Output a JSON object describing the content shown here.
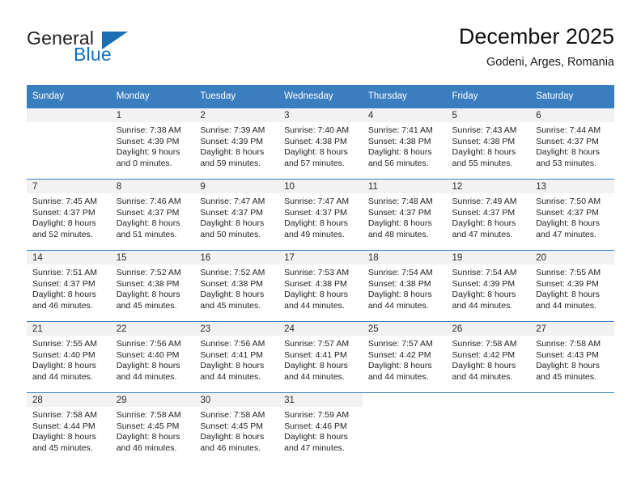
{
  "brand": {
    "name_part1": "General",
    "name_part2": "Blue",
    "triangle_color": "#1a6fb5",
    "text_color": "#231f20",
    "blue_color": "#1170bf"
  },
  "header": {
    "title": "December 2025",
    "location": "Godeni, Arges, Romania"
  },
  "theme": {
    "header_bg": "#3b7ebf",
    "header_text": "#ffffff",
    "daynum_band_bg": "#f2f2f2",
    "grid_line": "#3b7ebf",
    "body_text": "#222222"
  },
  "weekdays": [
    "Sunday",
    "Monday",
    "Tuesday",
    "Wednesday",
    "Thursday",
    "Friday",
    "Saturday"
  ],
  "weeks": [
    [
      {
        "day": "",
        "lines": []
      },
      {
        "day": "1",
        "lines": [
          "Sunrise: 7:38 AM",
          "Sunset: 4:39 PM",
          "Daylight: 9 hours",
          "and 0 minutes."
        ]
      },
      {
        "day": "2",
        "lines": [
          "Sunrise: 7:39 AM",
          "Sunset: 4:39 PM",
          "Daylight: 8 hours",
          "and 59 minutes."
        ]
      },
      {
        "day": "3",
        "lines": [
          "Sunrise: 7:40 AM",
          "Sunset: 4:38 PM",
          "Daylight: 8 hours",
          "and 57 minutes."
        ]
      },
      {
        "day": "4",
        "lines": [
          "Sunrise: 7:41 AM",
          "Sunset: 4:38 PM",
          "Daylight: 8 hours",
          "and 56 minutes."
        ]
      },
      {
        "day": "5",
        "lines": [
          "Sunrise: 7:43 AM",
          "Sunset: 4:38 PM",
          "Daylight: 8 hours",
          "and 55 minutes."
        ]
      },
      {
        "day": "6",
        "lines": [
          "Sunrise: 7:44 AM",
          "Sunset: 4:37 PM",
          "Daylight: 8 hours",
          "and 53 minutes."
        ]
      }
    ],
    [
      {
        "day": "7",
        "lines": [
          "Sunrise: 7:45 AM",
          "Sunset: 4:37 PM",
          "Daylight: 8 hours",
          "and 52 minutes."
        ]
      },
      {
        "day": "8",
        "lines": [
          "Sunrise: 7:46 AM",
          "Sunset: 4:37 PM",
          "Daylight: 8 hours",
          "and 51 minutes."
        ]
      },
      {
        "day": "9",
        "lines": [
          "Sunrise: 7:47 AM",
          "Sunset: 4:37 PM",
          "Daylight: 8 hours",
          "and 50 minutes."
        ]
      },
      {
        "day": "10",
        "lines": [
          "Sunrise: 7:47 AM",
          "Sunset: 4:37 PM",
          "Daylight: 8 hours",
          "and 49 minutes."
        ]
      },
      {
        "day": "11",
        "lines": [
          "Sunrise: 7:48 AM",
          "Sunset: 4:37 PM",
          "Daylight: 8 hours",
          "and 48 minutes."
        ]
      },
      {
        "day": "12",
        "lines": [
          "Sunrise: 7:49 AM",
          "Sunset: 4:37 PM",
          "Daylight: 8 hours",
          "and 47 minutes."
        ]
      },
      {
        "day": "13",
        "lines": [
          "Sunrise: 7:50 AM",
          "Sunset: 4:37 PM",
          "Daylight: 8 hours",
          "and 47 minutes."
        ]
      }
    ],
    [
      {
        "day": "14",
        "lines": [
          "Sunrise: 7:51 AM",
          "Sunset: 4:37 PM",
          "Daylight: 8 hours",
          "and 46 minutes."
        ]
      },
      {
        "day": "15",
        "lines": [
          "Sunrise: 7:52 AM",
          "Sunset: 4:38 PM",
          "Daylight: 8 hours",
          "and 45 minutes."
        ]
      },
      {
        "day": "16",
        "lines": [
          "Sunrise: 7:52 AM",
          "Sunset: 4:38 PM",
          "Daylight: 8 hours",
          "and 45 minutes."
        ]
      },
      {
        "day": "17",
        "lines": [
          "Sunrise: 7:53 AM",
          "Sunset: 4:38 PM",
          "Daylight: 8 hours",
          "and 44 minutes."
        ]
      },
      {
        "day": "18",
        "lines": [
          "Sunrise: 7:54 AM",
          "Sunset: 4:38 PM",
          "Daylight: 8 hours",
          "and 44 minutes."
        ]
      },
      {
        "day": "19",
        "lines": [
          "Sunrise: 7:54 AM",
          "Sunset: 4:39 PM",
          "Daylight: 8 hours",
          "and 44 minutes."
        ]
      },
      {
        "day": "20",
        "lines": [
          "Sunrise: 7:55 AM",
          "Sunset: 4:39 PM",
          "Daylight: 8 hours",
          "and 44 minutes."
        ]
      }
    ],
    [
      {
        "day": "21",
        "lines": [
          "Sunrise: 7:55 AM",
          "Sunset: 4:40 PM",
          "Daylight: 8 hours",
          "and 44 minutes."
        ]
      },
      {
        "day": "22",
        "lines": [
          "Sunrise: 7:56 AM",
          "Sunset: 4:40 PM",
          "Daylight: 8 hours",
          "and 44 minutes."
        ]
      },
      {
        "day": "23",
        "lines": [
          "Sunrise: 7:56 AM",
          "Sunset: 4:41 PM",
          "Daylight: 8 hours",
          "and 44 minutes."
        ]
      },
      {
        "day": "24",
        "lines": [
          "Sunrise: 7:57 AM",
          "Sunset: 4:41 PM",
          "Daylight: 8 hours",
          "and 44 minutes."
        ]
      },
      {
        "day": "25",
        "lines": [
          "Sunrise: 7:57 AM",
          "Sunset: 4:42 PM",
          "Daylight: 8 hours",
          "and 44 minutes."
        ]
      },
      {
        "day": "26",
        "lines": [
          "Sunrise: 7:58 AM",
          "Sunset: 4:42 PM",
          "Daylight: 8 hours",
          "and 44 minutes."
        ]
      },
      {
        "day": "27",
        "lines": [
          "Sunrise: 7:58 AM",
          "Sunset: 4:43 PM",
          "Daylight: 8 hours",
          "and 45 minutes."
        ]
      }
    ],
    [
      {
        "day": "28",
        "lines": [
          "Sunrise: 7:58 AM",
          "Sunset: 4:44 PM",
          "Daylight: 8 hours",
          "and 45 minutes."
        ]
      },
      {
        "day": "29",
        "lines": [
          "Sunrise: 7:58 AM",
          "Sunset: 4:45 PM",
          "Daylight: 8 hours",
          "and 46 minutes."
        ]
      },
      {
        "day": "30",
        "lines": [
          "Sunrise: 7:58 AM",
          "Sunset: 4:45 PM",
          "Daylight: 8 hours",
          "and 46 minutes."
        ]
      },
      {
        "day": "31",
        "lines": [
          "Sunrise: 7:59 AM",
          "Sunset: 4:46 PM",
          "Daylight: 8 hours",
          "and 47 minutes."
        ]
      },
      {
        "day": "",
        "lines": []
      },
      {
        "day": "",
        "lines": []
      },
      {
        "day": "",
        "lines": []
      }
    ]
  ]
}
